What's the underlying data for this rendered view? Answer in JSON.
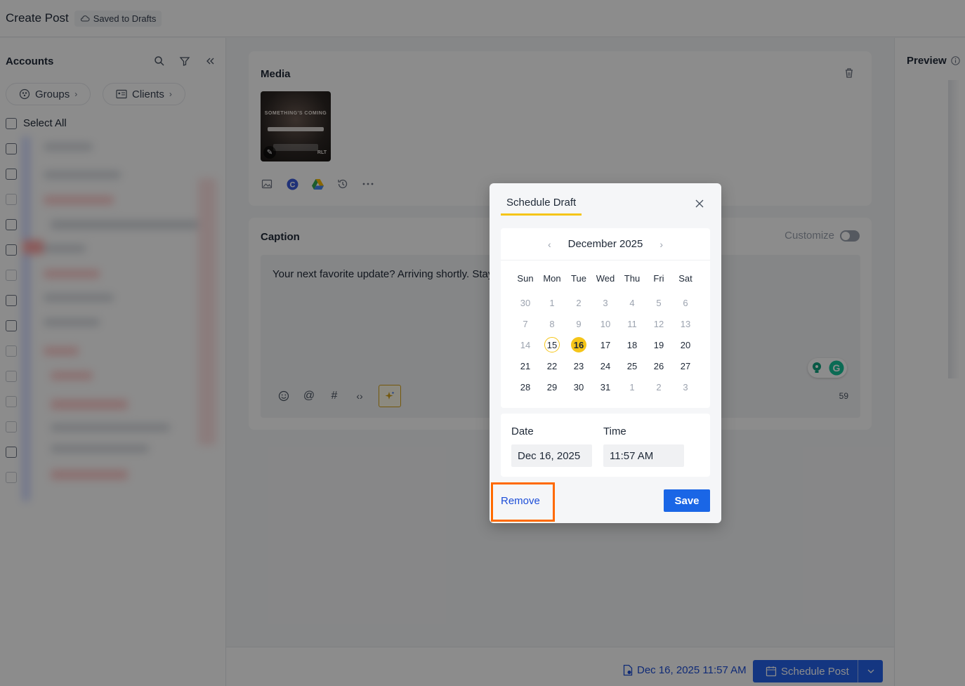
{
  "header": {
    "title": "Create Post",
    "saved_status": "Saved to Drafts"
  },
  "sidebar": {
    "title": "Accounts",
    "groups_label": "Groups",
    "clients_label": "Clients",
    "select_all_label": "Select All"
  },
  "media": {
    "title": "Media",
    "thumbnail_text": "SOMETHING'S COMING",
    "thumbnail_brand": "RLT"
  },
  "caption": {
    "title": "Caption",
    "text": "Your next favorite update? Arriving shortly. Stay",
    "customize_label": "Customize",
    "char_count": "59"
  },
  "preview": {
    "title": "Preview"
  },
  "bottom": {
    "scheduled_datetime": "Dec 16, 2025 11:57 AM",
    "schedule_button_label": "Schedule Post"
  },
  "modal": {
    "title": "Schedule Draft",
    "month_label": "December 2025",
    "weekdays": [
      "Sun",
      "Mon",
      "Tue",
      "Wed",
      "Thu",
      "Fri",
      "Sat"
    ],
    "weeks": [
      [
        {
          "d": "30",
          "m": true
        },
        {
          "d": "1",
          "m": true
        },
        {
          "d": "2",
          "m": true
        },
        {
          "d": "3",
          "m": true
        },
        {
          "d": "4",
          "m": true
        },
        {
          "d": "5",
          "m": true
        },
        {
          "d": "6",
          "m": true
        }
      ],
      [
        {
          "d": "7",
          "m": true
        },
        {
          "d": "8",
          "m": true
        },
        {
          "d": "9",
          "m": true
        },
        {
          "d": "10",
          "m": true
        },
        {
          "d": "11",
          "m": true
        },
        {
          "d": "12",
          "m": true
        },
        {
          "d": "13",
          "m": true
        }
      ],
      [
        {
          "d": "14",
          "m": true
        },
        {
          "d": "15",
          "today": true
        },
        {
          "d": "16",
          "sel": true
        },
        {
          "d": "17"
        },
        {
          "d": "18"
        },
        {
          "d": "19"
        },
        {
          "d": "20"
        }
      ],
      [
        {
          "d": "21"
        },
        {
          "d": "22"
        },
        {
          "d": "23"
        },
        {
          "d": "24"
        },
        {
          "d": "25"
        },
        {
          "d": "26"
        },
        {
          "d": "27"
        }
      ],
      [
        {
          "d": "28"
        },
        {
          "d": "29"
        },
        {
          "d": "30"
        },
        {
          "d": "31"
        },
        {
          "d": "1",
          "m": true
        },
        {
          "d": "2",
          "m": true
        },
        {
          "d": "3",
          "m": true
        }
      ]
    ],
    "date_label": "Date",
    "date_value": "Dec 16, 2025",
    "time_label": "Time",
    "time_value": "11:57 AM",
    "remove_label": "Remove",
    "save_label": "Save"
  },
  "colors": {
    "accent": "#f5c518",
    "primary": "#1a66e6",
    "highlight": "#ff6a00"
  }
}
